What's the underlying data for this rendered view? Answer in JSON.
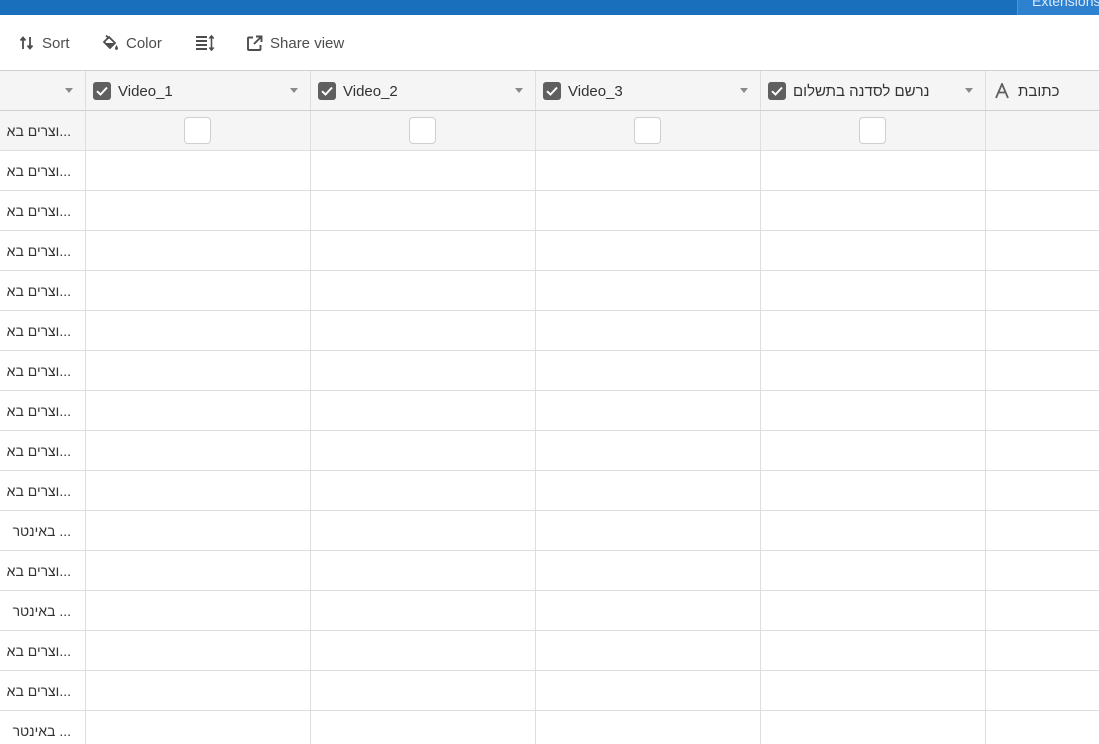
{
  "topbar": {
    "extensions_label": "Extensions"
  },
  "toolbar": {
    "sort_label": "Sort",
    "color_label": "Color",
    "share_label": "Share view"
  },
  "columns": [
    {
      "label": "",
      "type": "text"
    },
    {
      "label": "Video_1",
      "type": "checkbox"
    },
    {
      "label": "Video_2",
      "type": "checkbox"
    },
    {
      "label": "Video_3",
      "type": "checkbox"
    },
    {
      "label": "נרשם לסדנה בתשלום",
      "type": "checkbox"
    },
    {
      "label": "כתובת",
      "type": "text-field"
    }
  ],
  "rows": [
    "...וצרים בא",
    "...וצרים בא",
    "...וצרים בא",
    "...וצרים בא",
    "...וצרים בא",
    "...וצרים בא",
    "...וצרים בא",
    "...וצרים בא",
    "...וצרים בא",
    "...וצרים בא",
    "... באינטר",
    "...וצרים בא",
    "... באינטר",
    "...וצרים בא",
    "...וצרים בא",
    "... באינטר"
  ]
}
